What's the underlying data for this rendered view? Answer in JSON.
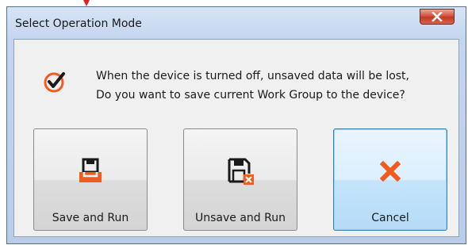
{
  "window": {
    "title": "Select Operation Mode",
    "close_icon": "close-icon"
  },
  "message": {
    "icon": "check-circle-icon",
    "line1": "When the device is turned off, unsaved data will be lost,",
    "line2": "Do you want to save current Work Group to the device?"
  },
  "buttons": [
    {
      "label": "Save and Run",
      "icon": "save-floppy-icon"
    },
    {
      "label": "Unsave and Run",
      "icon": "unsave-floppy-icon"
    },
    {
      "label": "Cancel",
      "icon": "cancel-x-icon"
    }
  ],
  "colors": {
    "accent_orange": "#f25a1e",
    "close_red": "#c23b24",
    "focus_blue": "#3c7fb1"
  }
}
